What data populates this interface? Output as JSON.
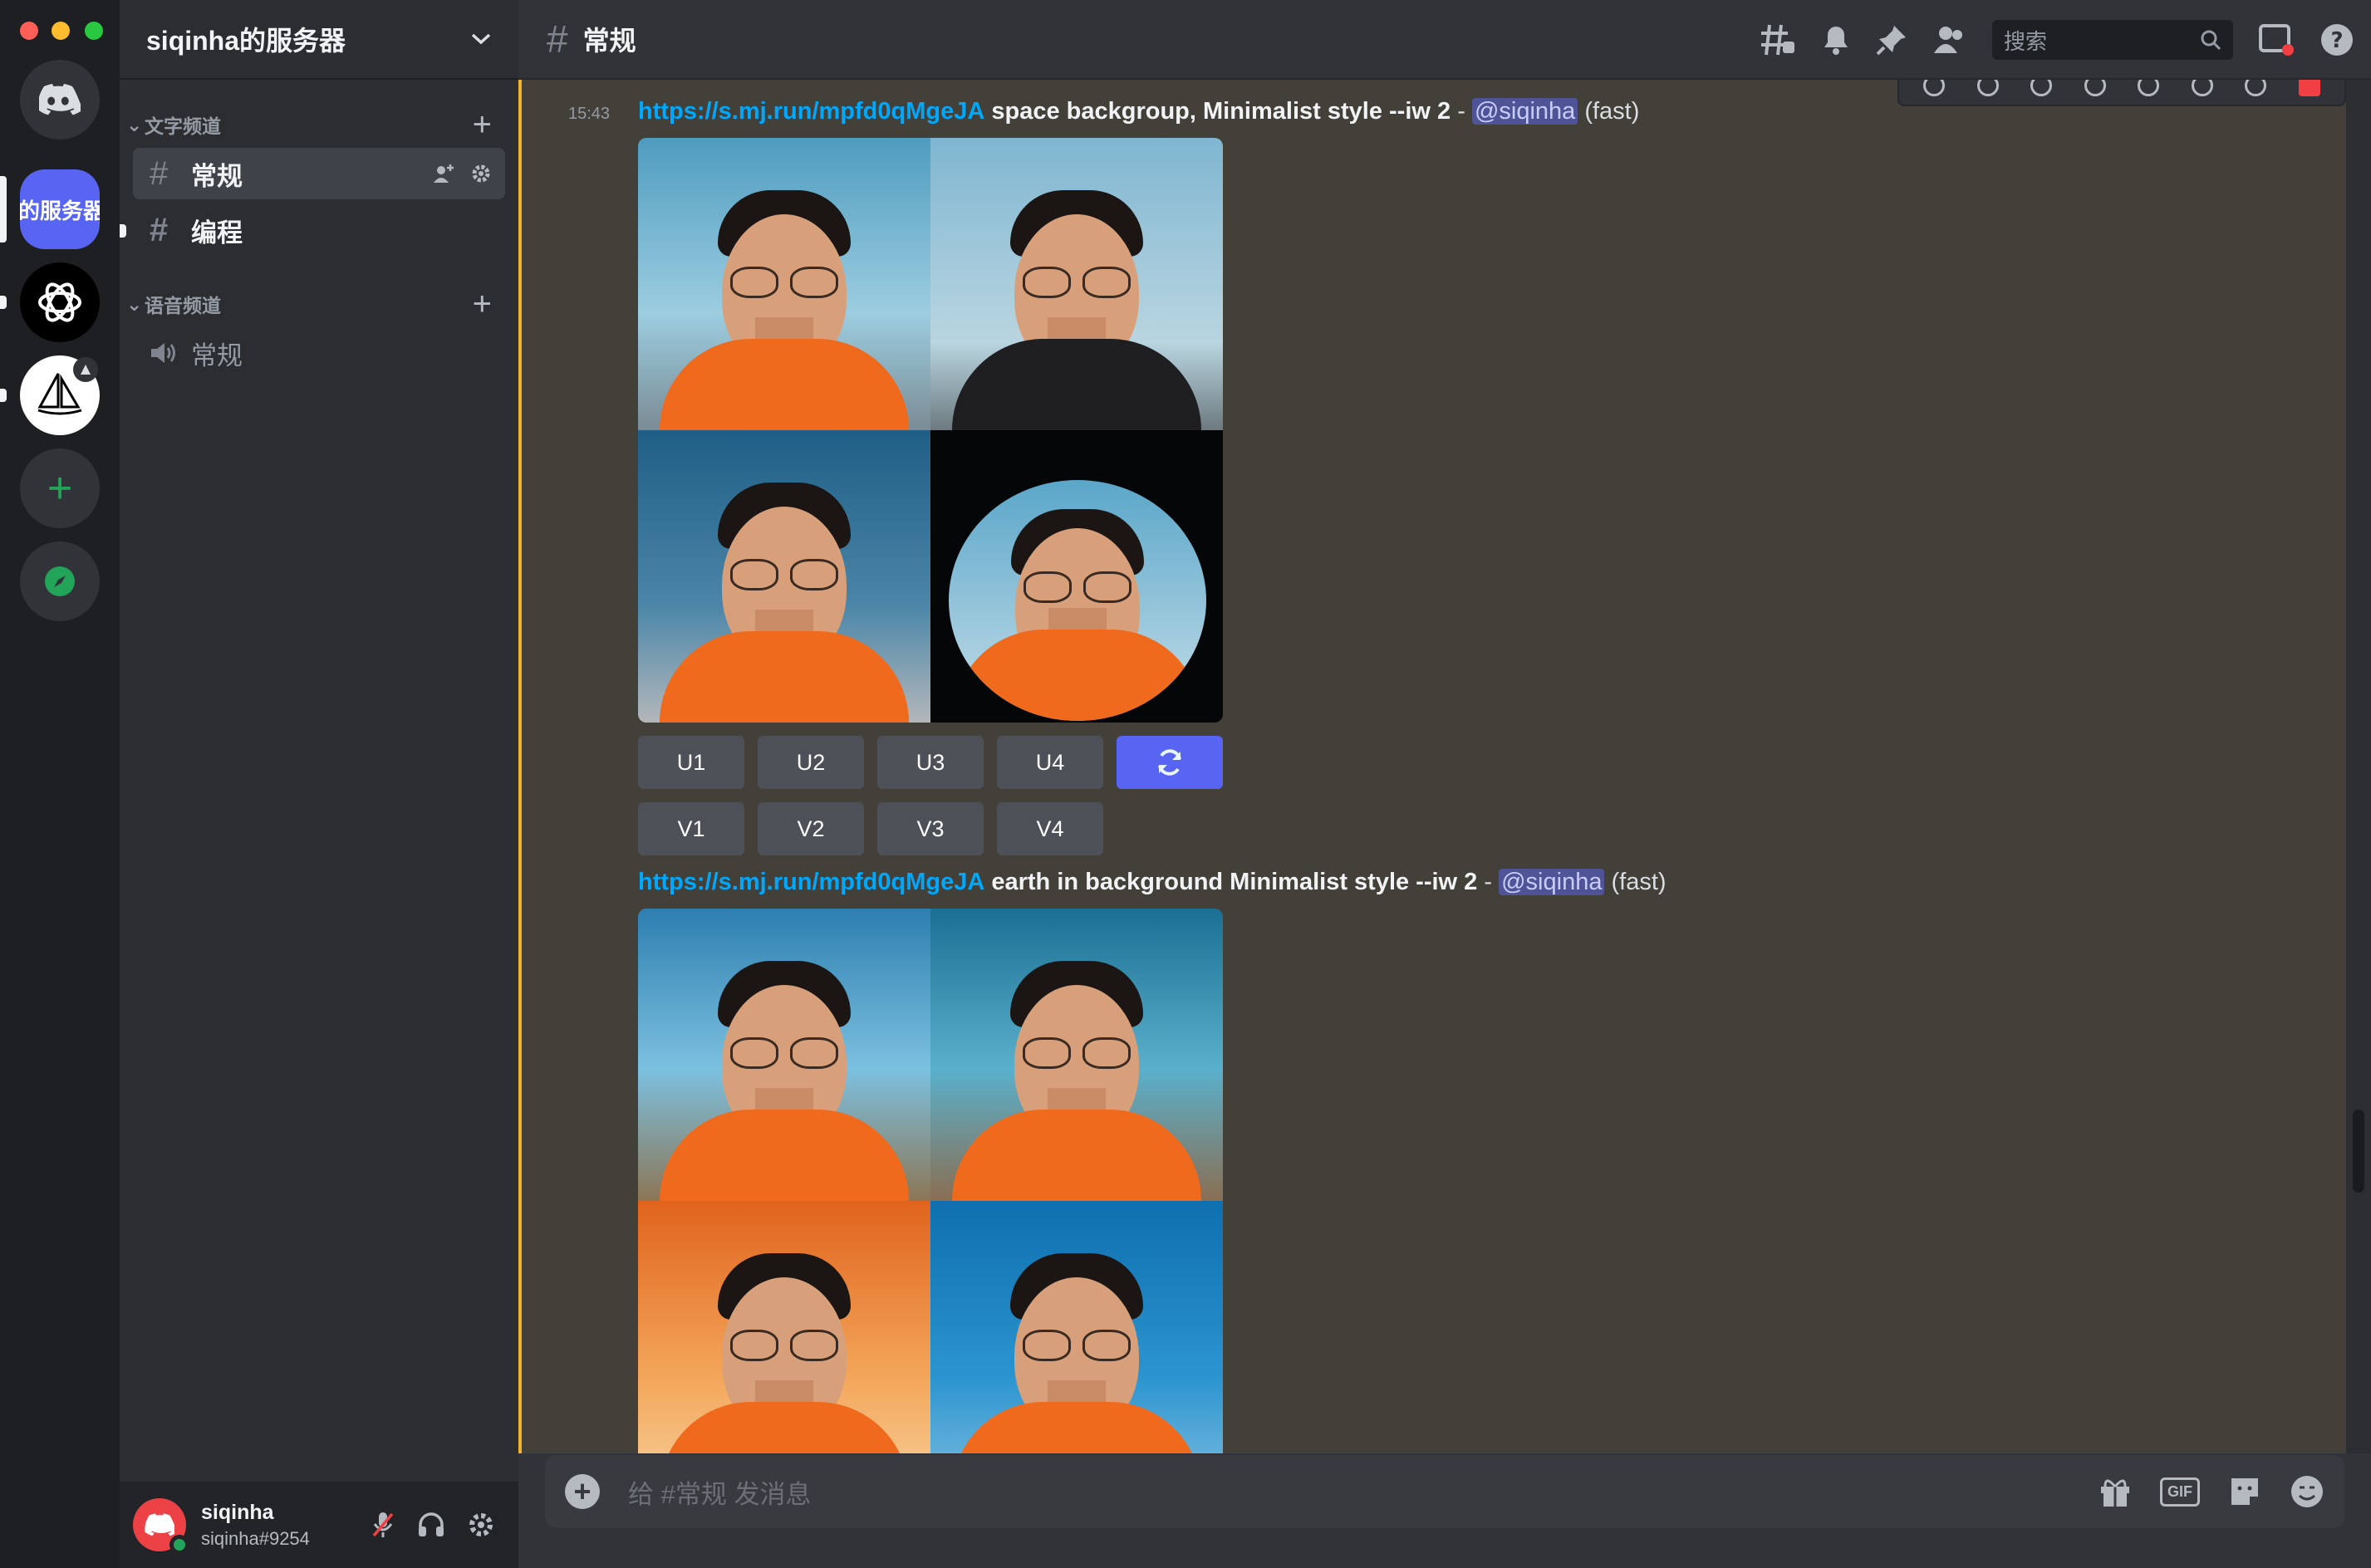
{
  "rail": {
    "active_server_label": "的服务器"
  },
  "sidebar": {
    "guild_name": "siqinha的服务器",
    "text_category": "文字频道",
    "voice_category": "语音频道",
    "text_channels": [
      {
        "name": "常规",
        "active": true
      },
      {
        "name": "编程",
        "active": false
      }
    ],
    "voice_channels": [
      {
        "name": "常规"
      }
    ]
  },
  "user": {
    "name": "siqinha",
    "tag": "siqinha#9254"
  },
  "header": {
    "channel_name": "常规",
    "search_placeholder": "搜索"
  },
  "messages": [
    {
      "time": "15:43",
      "link": "https://s.mj.run/mpfd0qMgeJA",
      "prompt": "space backgroup, Minimalist style --iw 2",
      "separator": "-",
      "mention": "@siqinha",
      "speed": "(fast)",
      "upscale_buttons": [
        "U1",
        "U2",
        "U3",
        "U4"
      ],
      "variation_buttons": [
        "V1",
        "V2",
        "V3",
        "V4"
      ]
    },
    {
      "link": "https://s.mj.run/mpfd0qMgeJA",
      "prompt": "earth in background Minimalist style --iw 2",
      "separator": "-",
      "mention": "@siqinha",
      "speed": "(fast)"
    }
  ],
  "composer": {
    "placeholder": "给 #常规 发消息",
    "gif_label": "GIF"
  },
  "colors": {
    "accent": "#5865f2",
    "link": "#00a8fc",
    "mention_bar": "#f0b232",
    "mention_bg": "#4f5496",
    "online": "#23a559",
    "danger": "#f23f43"
  }
}
